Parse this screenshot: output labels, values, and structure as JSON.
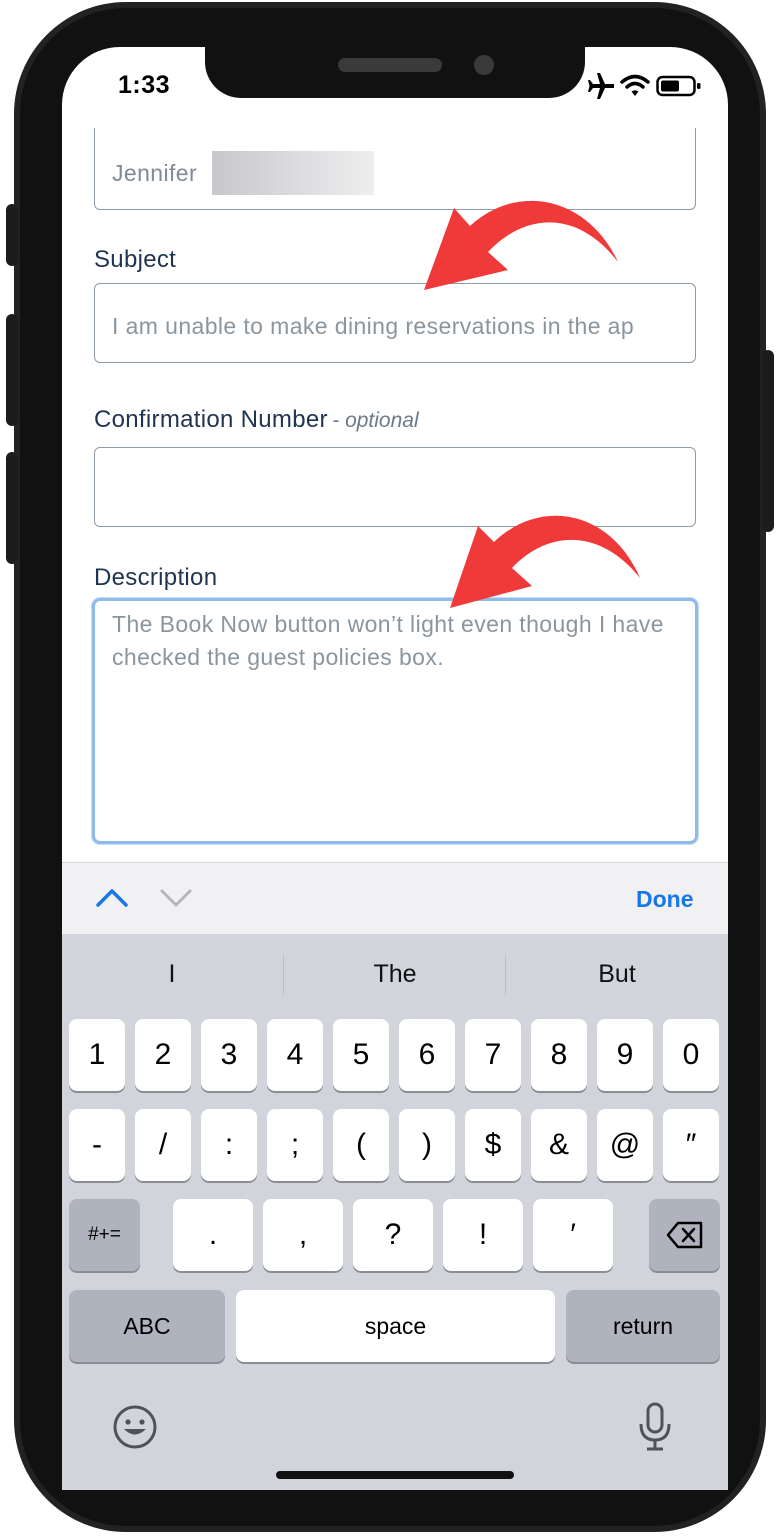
{
  "status_bar": {
    "time": "1:33"
  },
  "form": {
    "name_value": "Jennifer",
    "subject_label": "Subject",
    "subject_value": "I am unable to make dining reservations in the ap",
    "confirmation_label": "Confirmation Number",
    "confirmation_optional": "- optional",
    "confirmation_value": "",
    "description_label": "Description",
    "description_value": "The Book Now button won’t light even though I have checked the guest policies box."
  },
  "keyboard_toolbar": {
    "done_label": "Done"
  },
  "suggestions": [
    "I",
    "The",
    "But"
  ],
  "keys": {
    "row1": [
      "1",
      "2",
      "3",
      "4",
      "5",
      "6",
      "7",
      "8",
      "9",
      "0"
    ],
    "row2": [
      "-",
      "/",
      ":",
      ";",
      "(",
      ")",
      "$",
      "&",
      "@",
      "″"
    ],
    "row3": [
      ".",
      ",",
      "?",
      "!",
      "′"
    ],
    "symbols": "#+=",
    "abc": "ABC",
    "space": "space",
    "return": "return"
  },
  "colors": {
    "accent": "#1877e8",
    "arrow": "#f03a3a",
    "label": "#1e3450"
  }
}
